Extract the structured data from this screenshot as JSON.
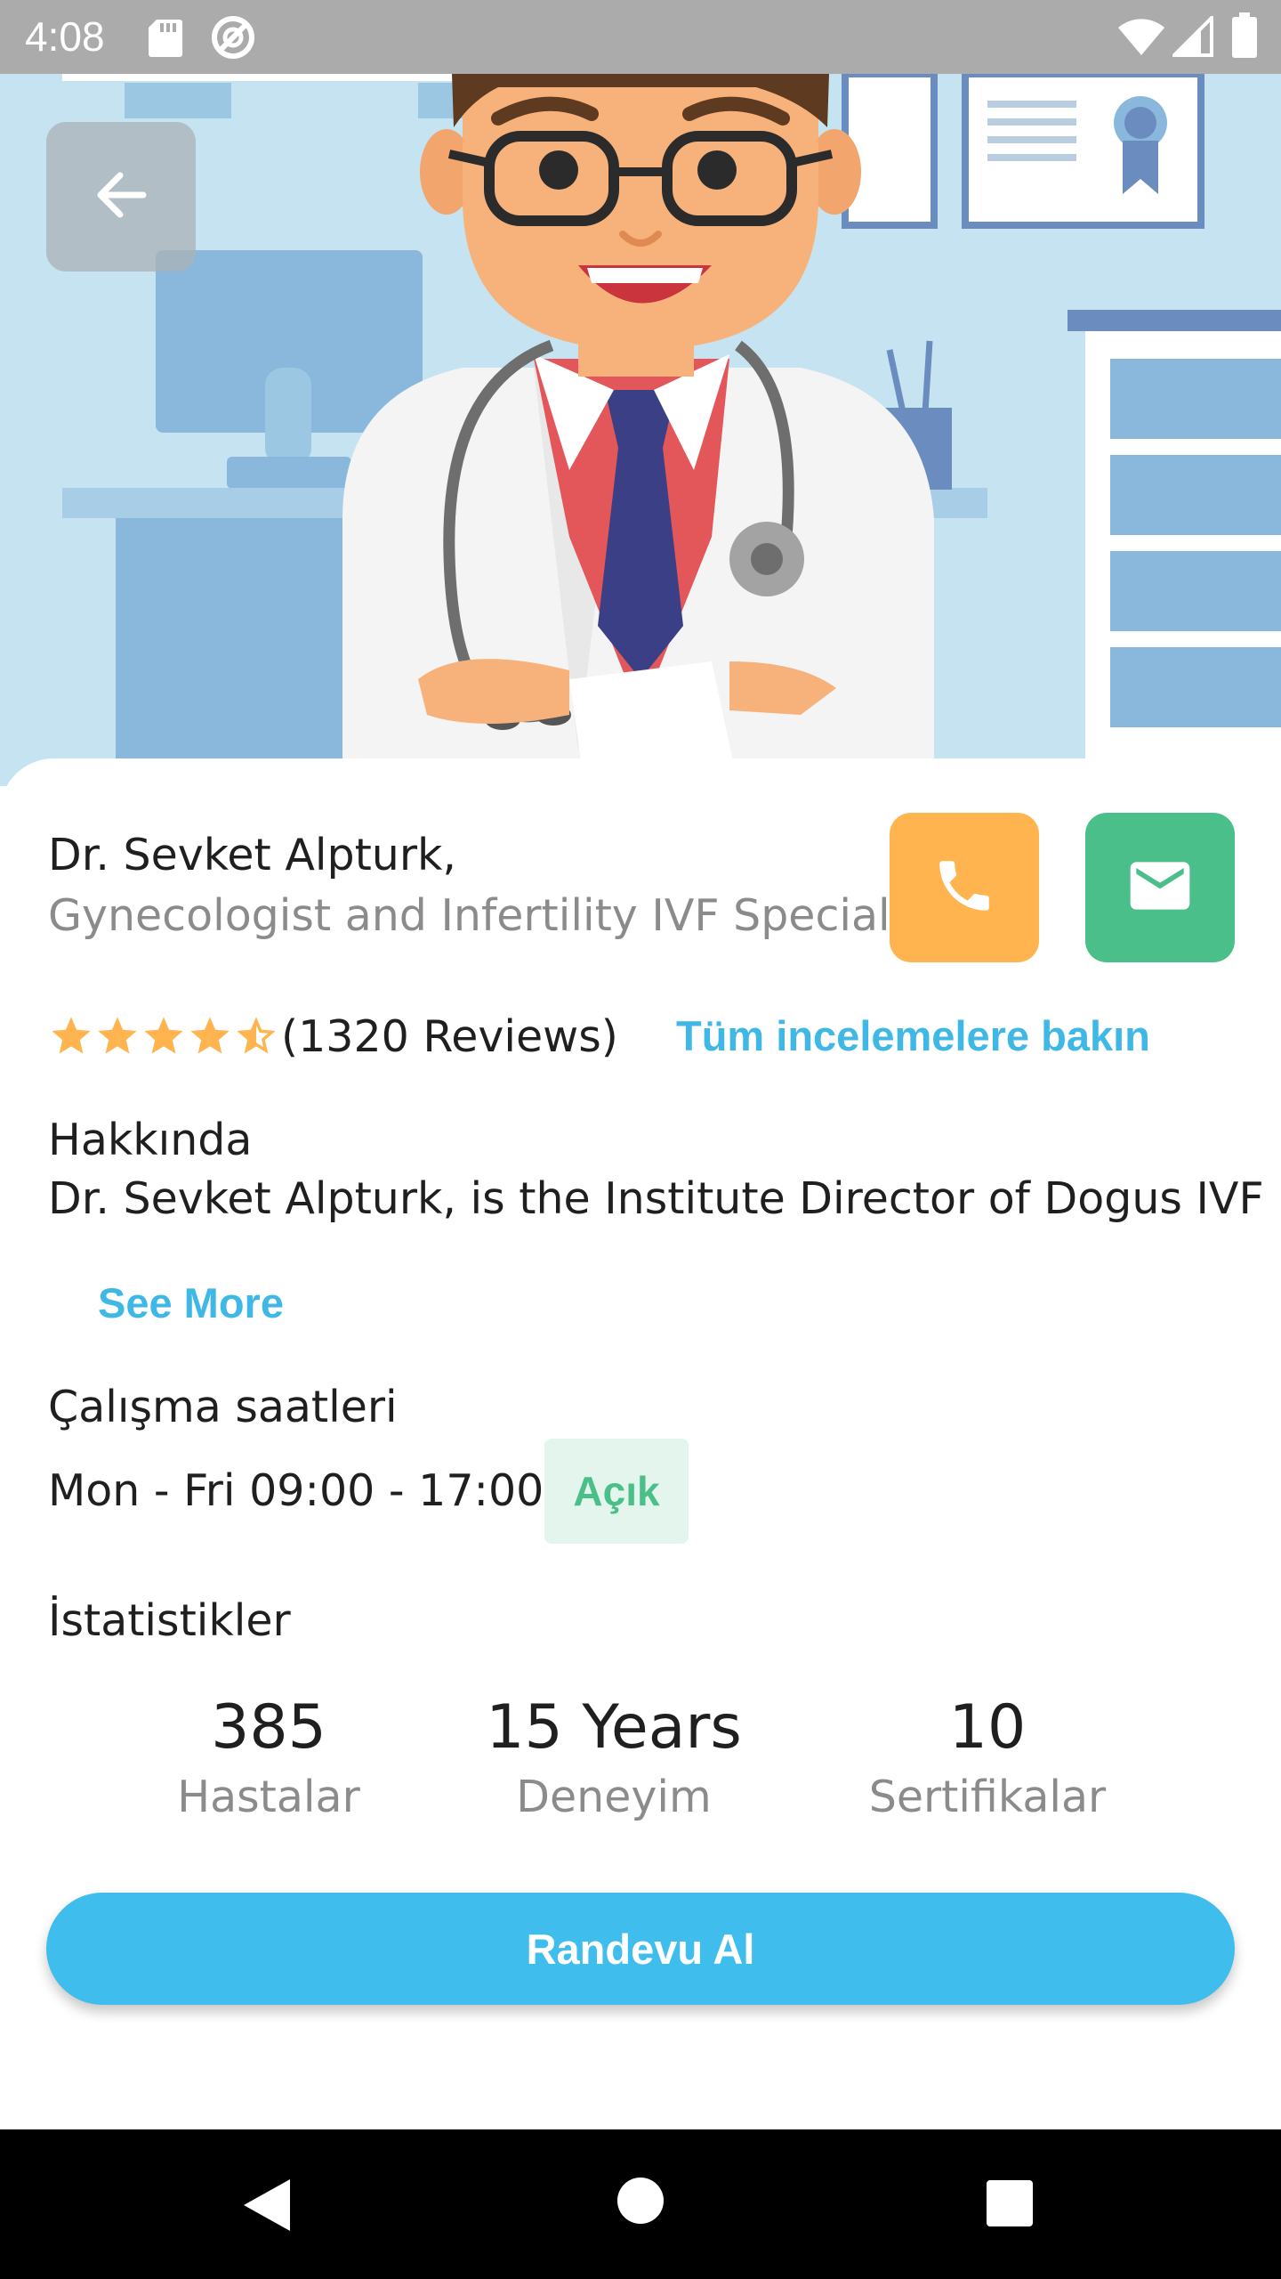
{
  "status_bar": {
    "time": "4:08",
    "icons": [
      "sd-card-icon",
      "sync-icon",
      "wifi-icon",
      "signal-icon",
      "battery-icon"
    ]
  },
  "hero": {
    "image": "doctor-illustration",
    "back_icon": "arrow-left-icon"
  },
  "doctor": {
    "name": "Dr. Sevket Alpturk,",
    "specialty": "Gynecologist and Infertility IVF Specialist"
  },
  "actions": {
    "call_icon": "phone-icon",
    "mail_icon": "mail-icon"
  },
  "rating": {
    "stars": 4.5,
    "reviews_text": "(1320 Reviews)",
    "all_reviews_link": "Tüm incelemelere bakın"
  },
  "about": {
    "heading": "Hakkında",
    "text": "Dr. Sevket Alpturk, is the Institute Director of Dogus IVF",
    "see_more": "See More"
  },
  "hours": {
    "heading": "Çalışma saatleri",
    "text": "Mon - Fri 09:00 - 17:00",
    "status": "Açık"
  },
  "stats": {
    "heading": "İstatistikler",
    "items": [
      {
        "value": "385",
        "label": "Hastalar"
      },
      {
        "value": "15 Years",
        "label": "Deneyim"
      },
      {
        "value": "10",
        "label": "Sertifikalar"
      }
    ]
  },
  "appointment_button": "Randevu Al",
  "colors": {
    "accent_blue": "#3fbdec",
    "call_orange": "#ffb44f",
    "mail_green": "#4abf8a",
    "star_yellow": "#ffb44f"
  }
}
